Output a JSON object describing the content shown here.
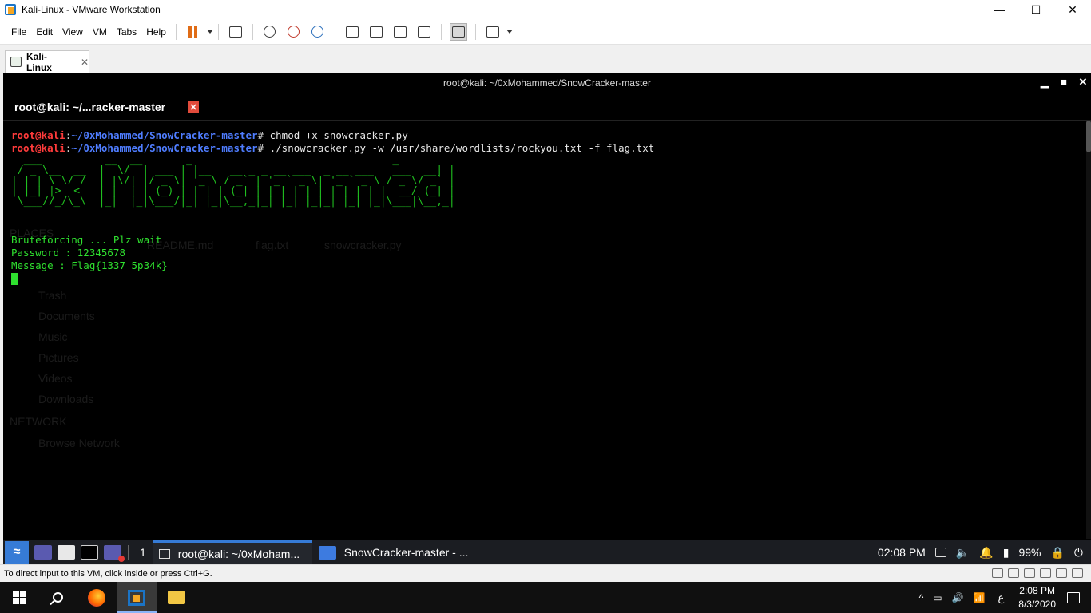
{
  "vmware": {
    "window_title": "Kali-Linux - VMware Workstation",
    "controls": {
      "minimize": "—",
      "maximize": "☐",
      "close": "✕"
    },
    "menu": [
      "File",
      "Edit",
      "View",
      "VM",
      "Tabs",
      "Help"
    ],
    "vm_tab": {
      "label": "Kali-Linux",
      "close": "✕"
    },
    "status_text": "To direct input to this VM, click inside or press Ctrl+G."
  },
  "terminal": {
    "window_title": "root@kali: ~/0xMohammed/SnowCracker-master",
    "controls": {
      "minimize": "▁",
      "maximize": "■",
      "close": "✕"
    },
    "tab_label": "root@kali: ~/...racker-master",
    "tab_close": "✕",
    "prompt_user": "root@kali",
    "prompt_path": "~/0xMohammed/SnowCracker-master",
    "prompt_sep": ":",
    "prompt_end": "# ",
    "cmd1": "chmod +x snowcracker.py",
    "cmd2": "./snowcracker.py -w /usr/share/wordlists/rockyou.txt -f flag.txt",
    "banner": [
      "  ___          __  __       _                                _ ",
      " / _ \\__  __  |  \\/  | ___ | |__   __ _ _ __ ___  _ __ ___   ___  __| |",
      "| | | \\ \\/ /  | |\\/| |/ _ \\| '_ \\ / _` | '_ ` _ \\| '_ ` _ \\ / _ \\/ _` |",
      "| |_| |>  <   | |  | | (_) | | | | (_| | | | | | | | | | | |  __/ (_| |",
      " \\___//_/\\_\\  |_|  |_|\\___/|_| |_|\\__,_|_| |_| |_|_| |_| |_|\\___|\\__,_|"
    ],
    "output": [
      "Bruteforcing ... Plz wait",
      "Password : 12345678",
      "Message : Flag{1337_5p34k}"
    ]
  },
  "ghost_filemanager": {
    "places": "PLACES",
    "files": [
      "README.md",
      "flag.txt",
      "snowcracker.py"
    ],
    "sidebar": [
      "Trash",
      "Documents",
      "Music",
      "Pictures",
      "Videos",
      "Downloads"
    ],
    "network": "NETWORK",
    "browse": "Browse Network"
  },
  "kali_panel": {
    "workspace": "1",
    "tasks": [
      "root@kali: ~/0xMoham...",
      "SnowCracker-master - ..."
    ],
    "time": "02:08 PM",
    "battery": "99%"
  },
  "windows_taskbar": {
    "time": "2:08 PM",
    "date": "8/3/2020",
    "language": "ع",
    "tray_up": "^"
  }
}
